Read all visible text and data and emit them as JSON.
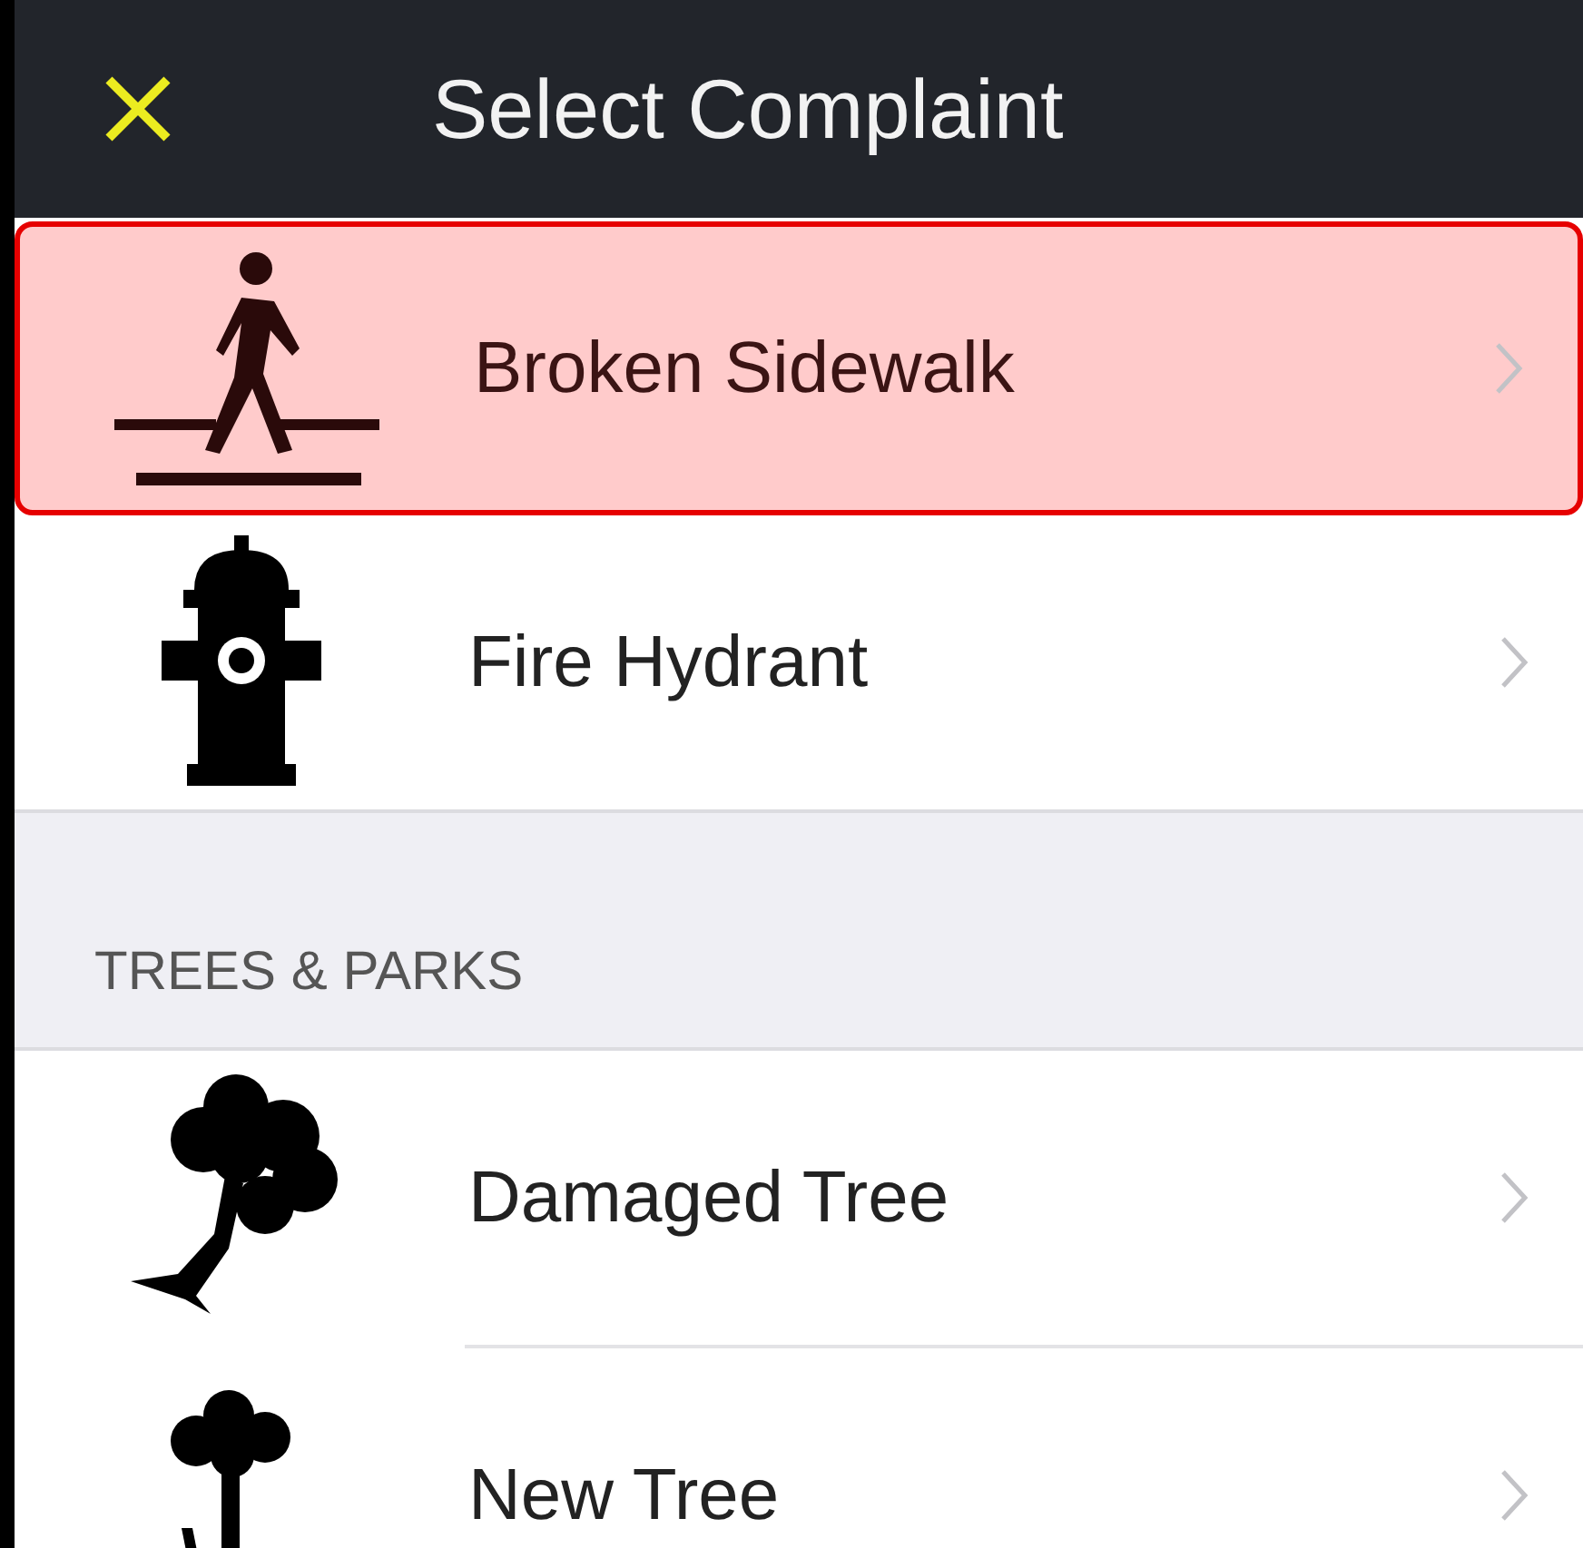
{
  "header": {
    "title": "Select Complaint"
  },
  "sections": [
    {
      "items": [
        {
          "label": "Broken Sidewalk",
          "kind": "pedestrian",
          "selected": true
        },
        {
          "label": "Fire Hydrant",
          "kind": "hydrant",
          "selected": false
        }
      ]
    },
    {
      "title": "TREES & PARKS",
      "items": [
        {
          "label": "Damaged Tree",
          "kind": "damaged",
          "selected": false
        },
        {
          "label": "New Tree",
          "kind": "tree",
          "selected": false
        }
      ]
    }
  ]
}
